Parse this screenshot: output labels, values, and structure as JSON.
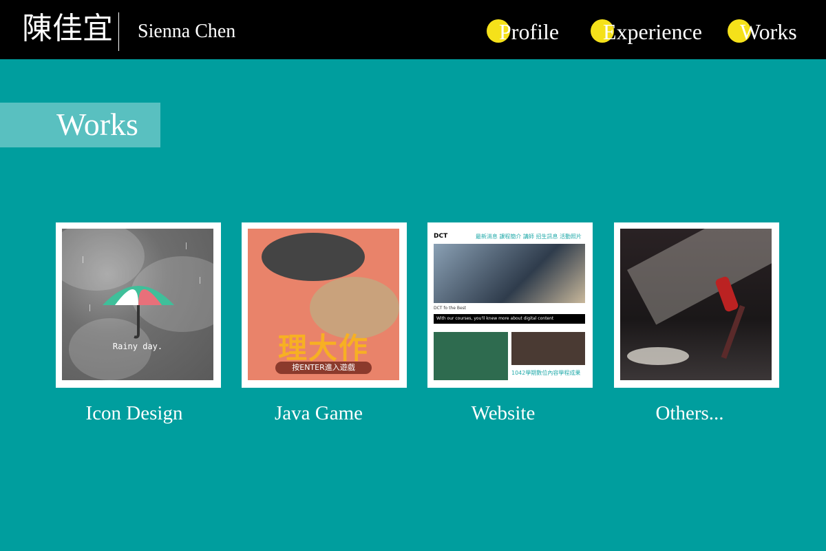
{
  "header": {
    "name_cn": "陳佳宜",
    "name_en": "Sienna Chen",
    "nav": [
      {
        "label": "Profile"
      },
      {
        "label": "Experience"
      },
      {
        "label": "Works"
      }
    ],
    "nav_dot_color": "#f5e11a"
  },
  "section": {
    "title": "Works"
  },
  "works": [
    {
      "label": "Icon Design",
      "thumb_text": "Rainy day."
    },
    {
      "label": "Java Game",
      "thumb_title": "理大作",
      "thumb_button": "按ENTER進入遊戲"
    },
    {
      "label": "Website",
      "thumb_logo": "DCT",
      "thumb_nav": "最新消息  課程簡介  講師  招生訊息  活動照片",
      "thumb_caption": "DCT fo the Best",
      "thumb_bar": "With our courses, you'll knew more about digital content",
      "thumb_footer": "1042學期數位內容學程成果"
    },
    {
      "label": "Others..."
    }
  ],
  "colors": {
    "background": "#009e9e",
    "header": "#000000",
    "accent": "#f5e11a"
  }
}
